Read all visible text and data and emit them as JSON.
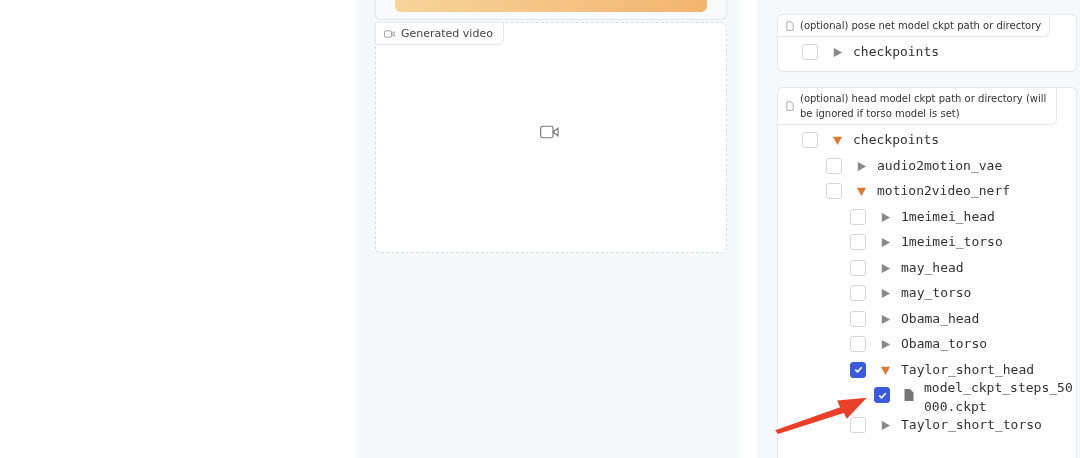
{
  "video": {
    "label": "Generated video"
  },
  "fields": [
    {
      "label": "(optional) pose net model ckpt path or directory",
      "tree": [
        {
          "name": "checkpoints",
          "kind": "folder",
          "checked": false,
          "expanded": false
        }
      ]
    },
    {
      "label": "(optional) head model ckpt path or directory (will be ignored if torso model is set)",
      "tree": [
        {
          "name": "checkpoints",
          "kind": "folder",
          "checked": false,
          "expanded": true,
          "children": [
            {
              "name": "audio2motion_vae",
              "kind": "folder",
              "checked": false,
              "expanded": false
            },
            {
              "name": "motion2video_nerf",
              "kind": "folder",
              "checked": false,
              "expanded": true,
              "children": [
                {
                  "name": "1meimei_head",
                  "kind": "folder",
                  "checked": false,
                  "expanded": false
                },
                {
                  "name": "1meimei_torso",
                  "kind": "folder",
                  "checked": false,
                  "expanded": false
                },
                {
                  "name": "may_head",
                  "kind": "folder",
                  "checked": false,
                  "expanded": false
                },
                {
                  "name": "may_torso",
                  "kind": "folder",
                  "checked": false,
                  "expanded": false
                },
                {
                  "name": "Obama_head",
                  "kind": "folder",
                  "checked": false,
                  "expanded": false
                },
                {
                  "name": "Obama_torso",
                  "kind": "folder",
                  "checked": false,
                  "expanded": false
                },
                {
                  "name": "Taylor_short_head",
                  "kind": "folder",
                  "checked": true,
                  "expanded": true,
                  "children": [
                    {
                      "name": "model_ckpt_steps_50000.ckpt",
                      "kind": "file",
                      "checked": true
                    }
                  ]
                },
                {
                  "name": "Taylor_short_torso",
                  "kind": "folder",
                  "checked": false,
                  "expanded": false
                }
              ]
            }
          ]
        }
      ]
    }
  ]
}
